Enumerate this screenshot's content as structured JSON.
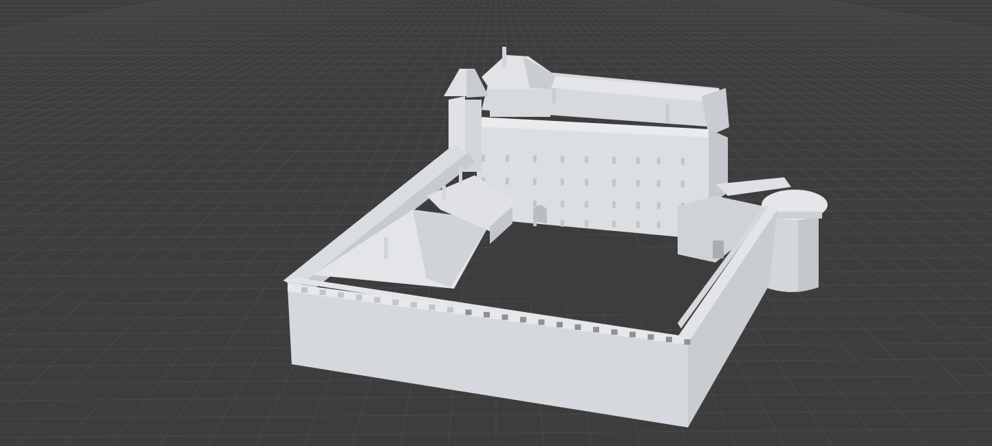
{
  "viewport": {
    "background": "#3d3d3d",
    "grid_color": "#4a4a4a",
    "model": {
      "surface_light": "#e2e4e7",
      "surface_mid": "#d3d6da",
      "surface_dark": "#c2c6cb",
      "roof_light": "#dadde1",
      "roof_dark": "#c7cacf",
      "opening": "#8e9298"
    }
  }
}
